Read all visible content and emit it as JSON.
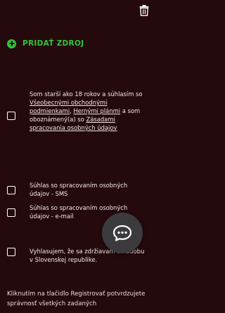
{
  "add_source": {
    "label": "PRIDAŤ ZDROJ"
  },
  "consents": [
    {
      "text_before": "Som starší ako 18 rokov a súhlasím so ",
      "link_terms": "Všeobecnými obchodnými podmienkami",
      "sep1": ", ",
      "link_rules": "Hernými plánmi",
      "text_mid": " a som oboznámený(a) so ",
      "link_privacy": "Zásadami spracovania osobných údajov",
      "checked": false
    },
    {
      "text": "Súhlas so spracovaním osobných údajov - SMS",
      "checked": false
    },
    {
      "text": "Súhlas so spracovaním osobných údajov - e-mail",
      "checked": false
    },
    {
      "text": "Vyhlasujem, že sa zdržiavam dlhodobu v Slovenskej republike.",
      "checked": false
    }
  ],
  "footer": {
    "text": "Kliknutím na tlačidlo Registrovať potvrdzujete správnosť všetkých zadaných"
  },
  "colors": {
    "background": "#250a0d",
    "accent": "#31c43a",
    "chat_button": "#3b3b3d"
  },
  "icons": {
    "delete": "trash-icon",
    "add": "plus-circle-icon",
    "chat": "chat-bubble-icon"
  }
}
